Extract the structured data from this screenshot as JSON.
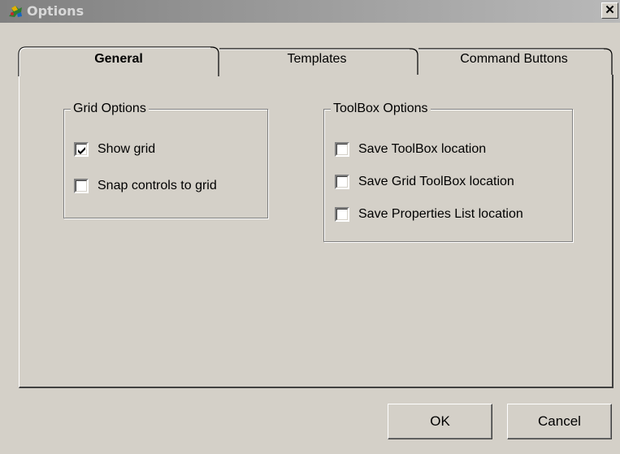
{
  "window": {
    "title": "Options",
    "close_glyph": "✕"
  },
  "tabs": [
    {
      "label": "General",
      "active": true
    },
    {
      "label": "Templates",
      "active": false
    },
    {
      "label": "Command Buttons",
      "active": false
    }
  ],
  "grid_options": {
    "legend": "Grid Options",
    "items": [
      {
        "label": "Show grid",
        "checked": true
      },
      {
        "label": "Snap controls to grid",
        "checked": false
      }
    ]
  },
  "toolbox_options": {
    "legend": "ToolBox Options",
    "items": [
      {
        "label": "Save ToolBox location",
        "checked": false
      },
      {
        "label": "Save Grid ToolBox location",
        "checked": false
      },
      {
        "label": "Save Properties List location",
        "checked": false
      }
    ]
  },
  "buttons": {
    "ok": "OK",
    "cancel": "Cancel"
  },
  "colors": {
    "face": "#d4d0c8",
    "title_gradient_start": "#808080",
    "title_gradient_end": "#b9b9b9"
  }
}
